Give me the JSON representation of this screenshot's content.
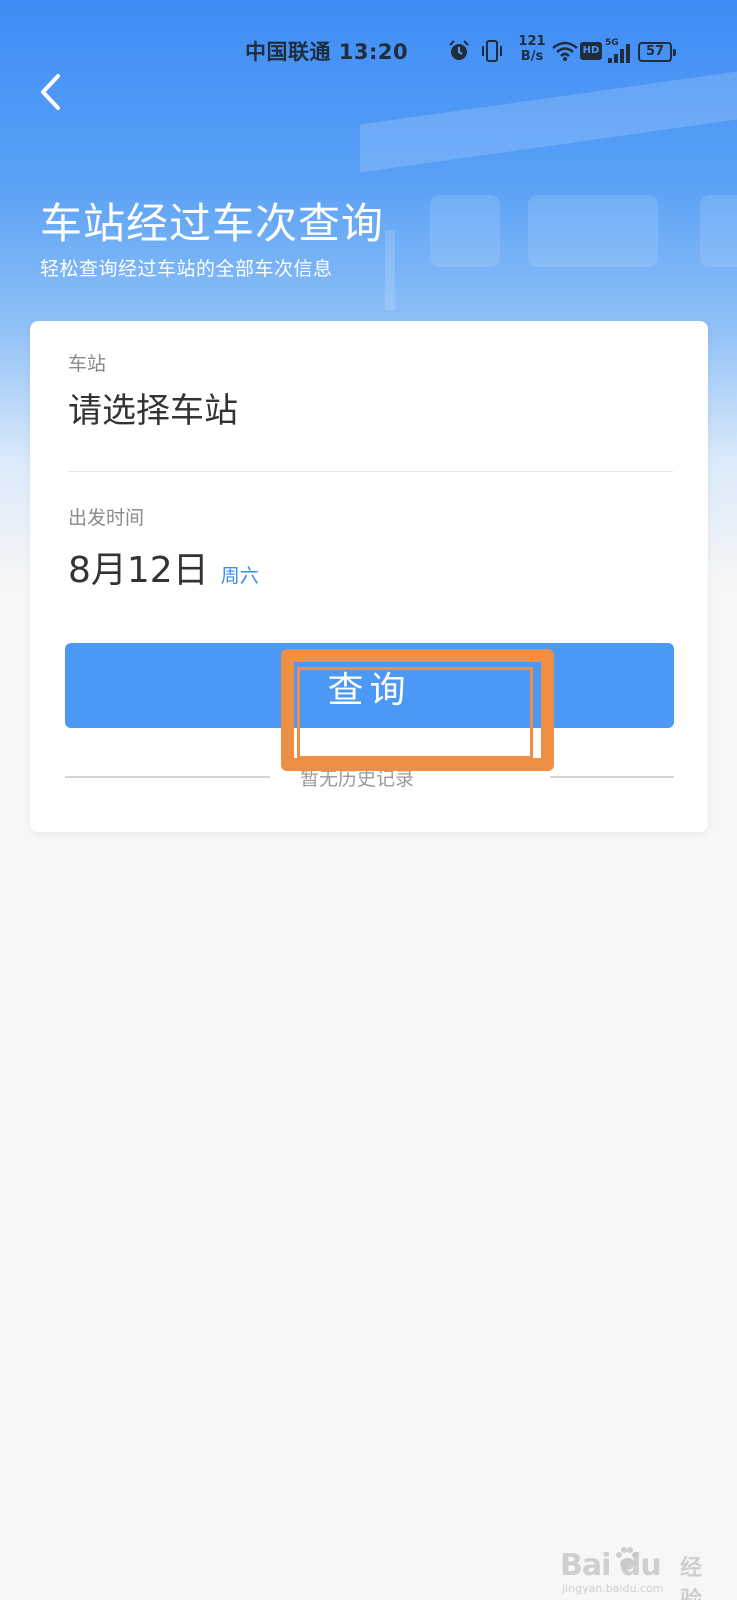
{
  "status_bar": {
    "carrier_time": "中国联通 13:20",
    "net_speed_value": "121",
    "net_speed_unit": "B/s",
    "hd_label": "HD",
    "network_type": "5G",
    "battery": "57"
  },
  "header": {
    "back_icon": "chevron-left-icon",
    "title": "车站经过车次查询",
    "subtitle": "轻松查询经过车站的全部车次信息"
  },
  "form": {
    "station_label": "车站",
    "station_placeholder": "请选择车站",
    "date_label": "出发时间",
    "date_value": "8月12日",
    "weekday": "周六",
    "query_button": "查询",
    "history_link": "暂无历史记录"
  },
  "watermark": {
    "logo": "Bai du",
    "text": "经验",
    "url": "jingyan.baidu.com"
  },
  "colors": {
    "accent": "#4c98f5",
    "highlight": "#ef8f45",
    "weekday": "#3a8ee6"
  }
}
